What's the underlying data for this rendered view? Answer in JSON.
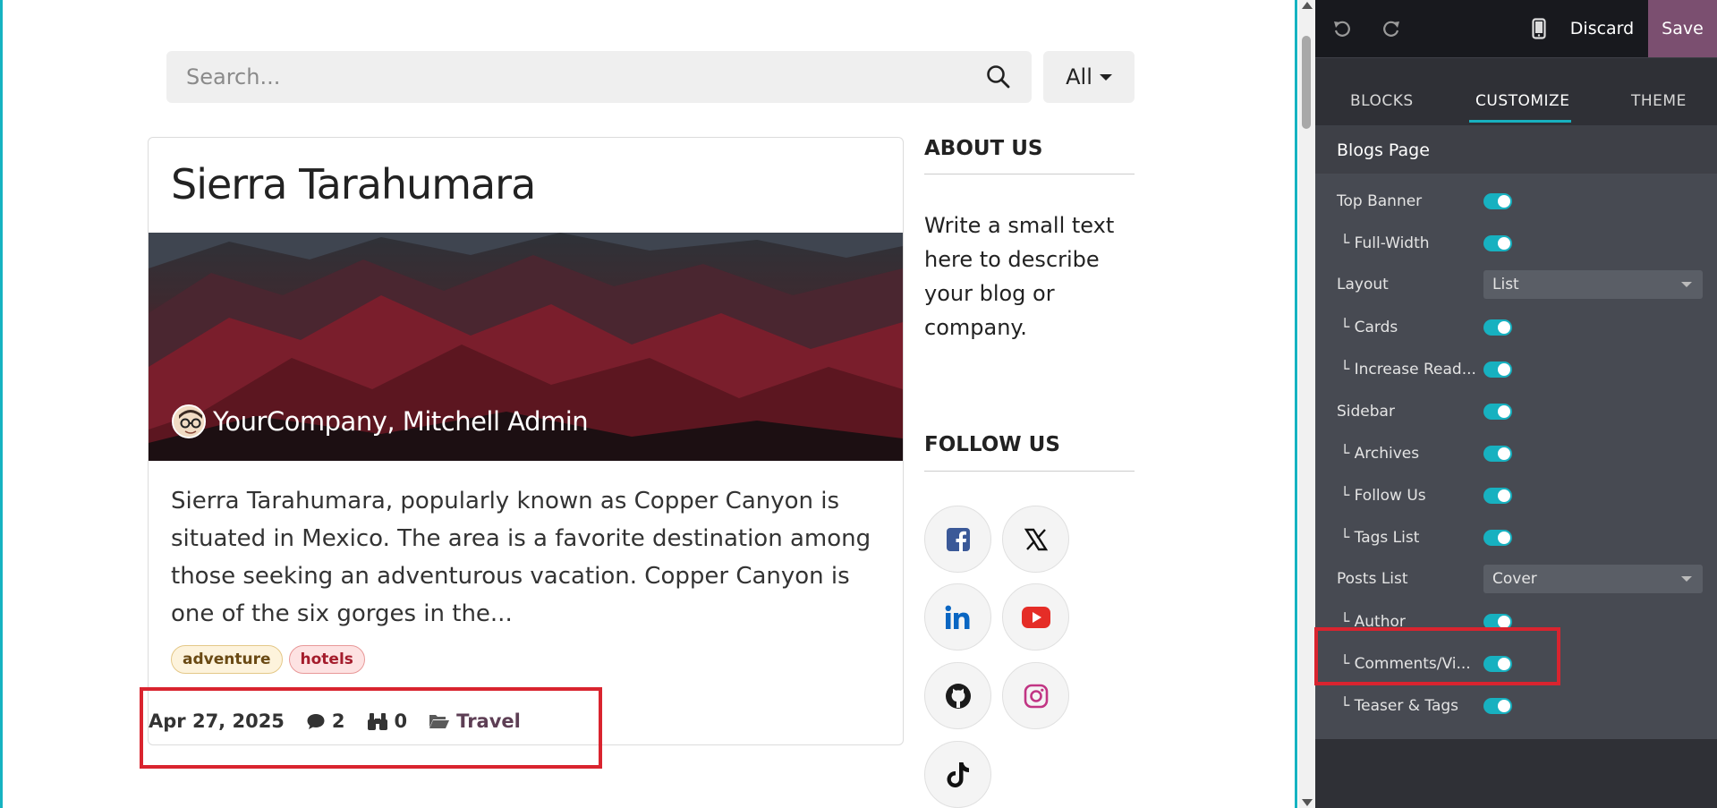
{
  "search": {
    "placeholder": "Search...",
    "filter_label": "All"
  },
  "post": {
    "title": "Sierra Tarahumara",
    "author": "YourCompany, Mitchell Admin",
    "teaser": "Sierra Tarahumara, popularly known as Copper Canyon is situated in Mexico. The area is a favorite destination among those seeking an adventurous vacation. Copper Canyon is one of the six gorges in the...",
    "tags": [
      "adventure",
      "hotels"
    ],
    "date": "Apr 27, 2025",
    "comments": "2",
    "views": "0",
    "category": "Travel"
  },
  "sidebar": {
    "about_title": "ABOUT US",
    "about_text": "Write a small text here to describe your blog or company.",
    "follow_title": "FOLLOW US",
    "socials": [
      "facebook-icon",
      "x-icon",
      "linkedin-icon",
      "youtube-icon",
      "github-icon",
      "instagram-icon",
      "tiktok-icon"
    ]
  },
  "editor": {
    "discard_label": "Discard",
    "save_label": "Save",
    "tabs": [
      "BLOCKS",
      "CUSTOMIZE",
      "THEME"
    ],
    "active_tab": "CUSTOMIZE",
    "section_title": "Blogs Page",
    "options": [
      {
        "label": "Top Banner",
        "sub": false,
        "control": "toggle",
        "on": true
      },
      {
        "label": "└ Full-Width",
        "sub": true,
        "control": "toggle",
        "on": true
      },
      {
        "label": "Layout",
        "sub": false,
        "control": "select",
        "value": "List"
      },
      {
        "label": "└ Cards",
        "sub": true,
        "control": "toggle",
        "on": true
      },
      {
        "label": "└ Increase Read...",
        "sub": true,
        "control": "toggle",
        "on": true
      },
      {
        "label": "Sidebar",
        "sub": false,
        "control": "toggle",
        "on": true
      },
      {
        "label": "└ Archives",
        "sub": true,
        "control": "toggle",
        "on": true
      },
      {
        "label": "└ Follow Us",
        "sub": true,
        "control": "toggle",
        "on": true
      },
      {
        "label": "└ Tags List",
        "sub": true,
        "control": "toggle",
        "on": true
      },
      {
        "label": "Posts List",
        "sub": false,
        "control": "select",
        "value": "Cover"
      },
      {
        "label": "└ Author",
        "sub": true,
        "control": "toggle",
        "on": true
      },
      {
        "label": "└ Comments/Vi...",
        "sub": true,
        "control": "toggle",
        "on": true
      },
      {
        "label": "└ Teaser & Tags",
        "sub": true,
        "control": "toggle",
        "on": true
      }
    ]
  },
  "colors": {
    "accent": "#17b1c0",
    "save": "#7b4f70",
    "highlight": "#d9242f",
    "category": "#5d3e54"
  }
}
